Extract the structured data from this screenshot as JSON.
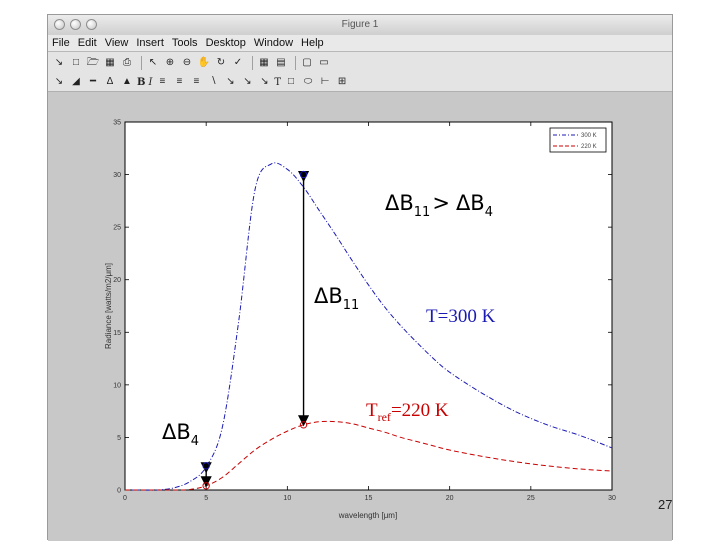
{
  "window": {
    "title": "Figure 1"
  },
  "menu": {
    "items": [
      "File",
      "Edit",
      "View",
      "Insert",
      "Tools",
      "Desktop",
      "Window",
      "Help"
    ]
  },
  "toolbar": {
    "row1_icons": [
      "arrow-icon",
      "new-figure-icon",
      "open-icon",
      "save-icon",
      "print-icon",
      "select-arrow-icon",
      "zoom-in-icon",
      "zoom-out-icon",
      "pan-icon",
      "rotate-icon",
      "data-cursor-icon",
      "colorbar-icon",
      "legend-icon",
      "hide-tools-icon",
      "show-tools-icon"
    ],
    "row2_bold": "B",
    "row2_italic": "I",
    "row2_text_tool": "T"
  },
  "annotations": {
    "delta_b11_gt_b4": {
      "delta": "ΔB",
      "sub1": "11",
      "gt": ">",
      "delta2": "ΔB",
      "sub2": "4"
    },
    "delta_b11": {
      "delta": "ΔB",
      "sub": "11"
    },
    "delta_b4": {
      "delta": "ΔB",
      "sub": "4"
    },
    "t300": "T=300 K",
    "tref": {
      "prefix": "T",
      "sub": "ref",
      "suffix": "=220 K"
    }
  },
  "page_number": "27",
  "colors": {
    "t300": "#1b1bb4",
    "tref": "#c80000",
    "window_bg": "#c8c8c8"
  },
  "chart_data": {
    "type": "line",
    "xlabel": "wavelength [μm]",
    "ylabel": "Radiance [watts/m2/μm]",
    "xlim": [
      0,
      30
    ],
    "ylim": [
      0,
      35
    ],
    "xticks": [
      0,
      5,
      10,
      15,
      20,
      25,
      30
    ],
    "yticks": [
      0,
      5,
      10,
      15,
      20,
      25,
      30,
      35
    ],
    "legend_position": "top-right",
    "series": [
      {
        "name": "300 K",
        "style": "dash-dot",
        "x": [
          0,
          1,
          2,
          3,
          4,
          5,
          6,
          7,
          8,
          9,
          10,
          11,
          12,
          13,
          14,
          15,
          16,
          17,
          18,
          19,
          20,
          22,
          24,
          26,
          28,
          30
        ],
        "y": [
          0,
          0,
          0,
          0.2,
          0.8,
          2.2,
          6.0,
          16.0,
          28.5,
          31.0,
          30.5,
          28.8,
          26.5,
          24.2,
          21.8,
          19.5,
          17.4,
          15.6,
          14.0,
          12.5,
          11.2,
          9.2,
          7.5,
          6.2,
          5.2,
          4.0
        ]
      },
      {
        "name": "220 K",
        "style": "dashed",
        "x": [
          0,
          2,
          3,
          4,
          5,
          6,
          7,
          8,
          9,
          10,
          11,
          12,
          13,
          14,
          15,
          16,
          17,
          18,
          19,
          20,
          22,
          24,
          26,
          28,
          30
        ],
        "y": [
          0,
          0,
          0,
          0.05,
          0.4,
          1.2,
          2.5,
          3.8,
          4.8,
          5.6,
          6.2,
          6.5,
          6.5,
          6.3,
          5.9,
          5.5,
          5.0,
          4.6,
          4.2,
          3.8,
          3.2,
          2.7,
          2.3,
          2.0,
          1.8
        ]
      }
    ],
    "markers": [
      {
        "x": 5,
        "y": 2.3,
        "series": "300 K"
      },
      {
        "x": 5,
        "y": 0.4,
        "series": "220 K"
      },
      {
        "x": 11,
        "y": 30.0,
        "series": "300 K"
      },
      {
        "x": 11,
        "y": 6.2,
        "series": "220 K"
      }
    ]
  }
}
